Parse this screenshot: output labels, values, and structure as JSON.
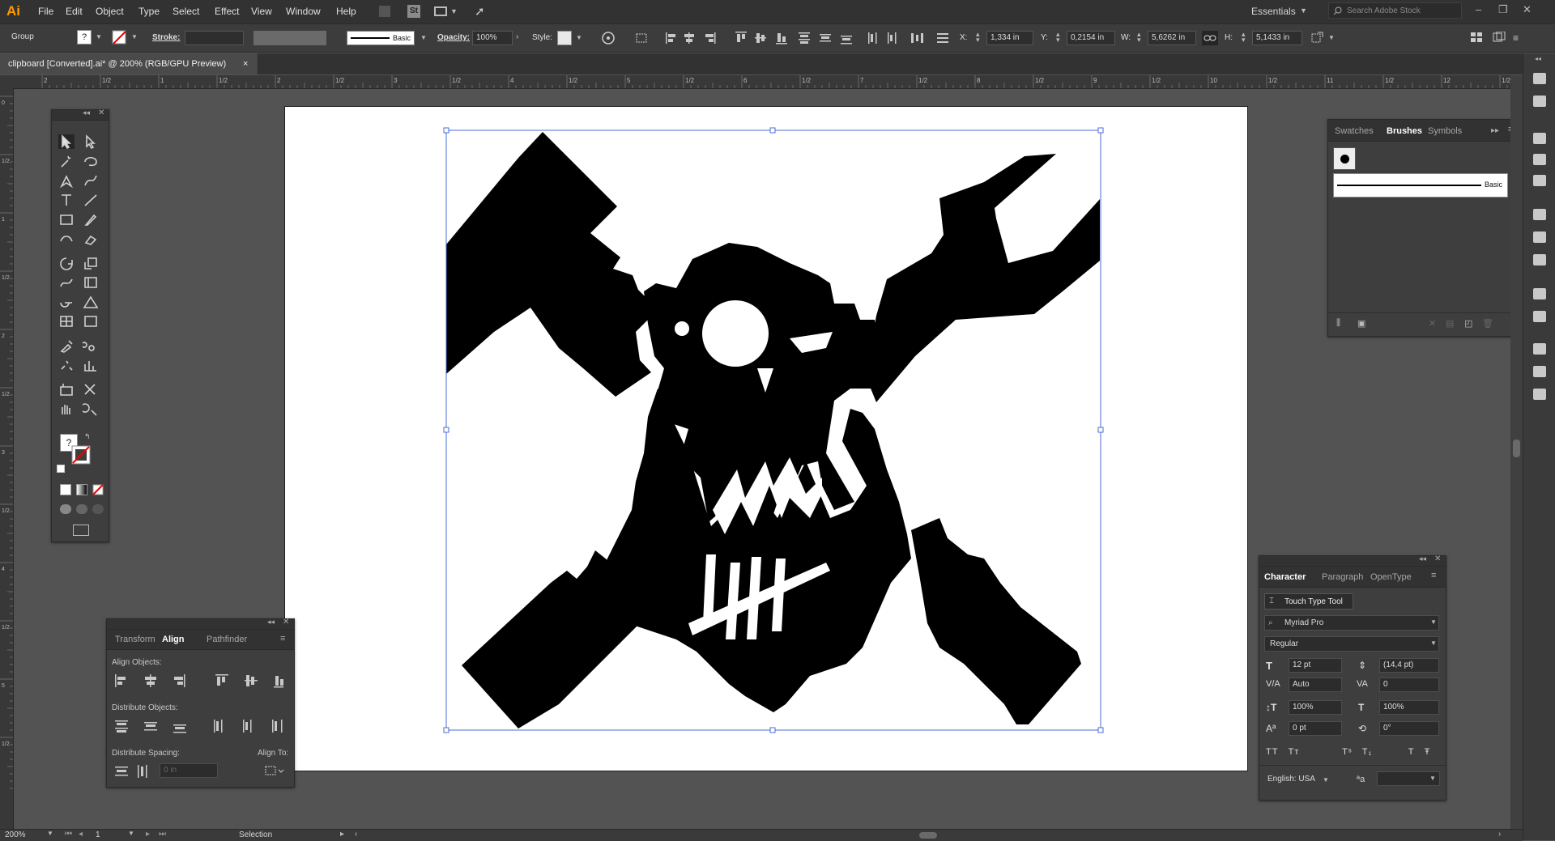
{
  "menubar": {
    "app_logo": "Ai",
    "items": [
      "File",
      "Edit",
      "Object",
      "Type",
      "Select",
      "Effect",
      "View",
      "Window",
      "Help"
    ],
    "workspace": "Essentials",
    "search_placeholder": "Search Adobe Stock"
  },
  "controlbar": {
    "selection_type": "Group",
    "fill_value": "?",
    "stroke_label": "Stroke:",
    "brush_label": "Basic",
    "opacity_label": "Opacity:",
    "opacity_value": "100%",
    "style_label": "Style:",
    "x_label": "X:",
    "x_value": "1,334 in",
    "y_label": "Y:",
    "y_value": "0,2154 in",
    "w_label": "W:",
    "w_value": "5,6262 in",
    "h_label": "H:",
    "h_value": "5,1433 in"
  },
  "document": {
    "tab_title": "clipboard [Converted].ai* @ 200% (RGB/GPU Preview)",
    "tab_close": "×"
  },
  "ruler": {
    "h_labels": [
      "2",
      "1/2",
      "1",
      "1/2",
      "2",
      "1/2",
      "3",
      "1/2",
      "4",
      "1/2",
      "5",
      "1/2",
      "6",
      "1/2",
      "7",
      "1/2",
      "8",
      "1/2",
      "9",
      "1/2",
      "10",
      "1/2",
      "11",
      "1/2",
      "12",
      "1/2"
    ],
    "v_labels": [
      "0",
      "1/2",
      "1",
      "1/2",
      "2",
      "1/2",
      "3",
      "1/2",
      "4",
      "1/2",
      "5",
      "1/2"
    ]
  },
  "tools_panel": {
    "fill_label": "?"
  },
  "align_panel": {
    "tabs": [
      "Transform",
      "Align",
      "Pathfinder"
    ],
    "align_objects": "Align Objects:",
    "distribute_objects": "Distribute Objects:",
    "distribute_spacing": "Distribute Spacing:",
    "align_to": "Align To:",
    "spacing_value": "0 in"
  },
  "brushes_panel": {
    "tabs": [
      "Swatches",
      "Brushes",
      "Symbols"
    ],
    "brush_name": "Basic"
  },
  "character_panel": {
    "tabs": [
      "Character",
      "Paragraph",
      "OpenType"
    ],
    "touch_type": "Touch Type Tool",
    "font_family": "Myriad Pro",
    "font_style": "Regular",
    "font_size": "12 pt",
    "leading": "(14,4 pt)",
    "kerning": "Auto",
    "tracking": "0",
    "vscale": "100%",
    "hscale": "100%",
    "baseline": "0 pt",
    "rotation": "0°",
    "language": "English: USA",
    "aa_label": "ªa"
  },
  "statusbar": {
    "zoom": "200%",
    "artboard_num": "1",
    "tool_name": "Selection"
  },
  "colors": {
    "ui_dark": "#323232",
    "canvas_bg": "#535353",
    "selection_blue": "#4a6bd6",
    "logo_orange": "#ff9a00"
  }
}
